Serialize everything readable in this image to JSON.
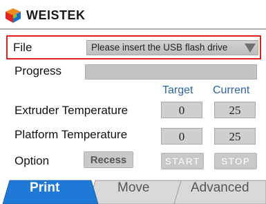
{
  "header": {
    "brand": "WEISTEK",
    "logo_icon": "weistek-cube-logo-icon"
  },
  "file": {
    "label": "File",
    "selected": "Please insert the USB flash drive",
    "dropdown_icon": "triangle-down-icon"
  },
  "progress": {
    "label": "Progress",
    "value": 0
  },
  "columns": {
    "target": "Target",
    "current": "Current"
  },
  "extruder": {
    "label": "Extruder Temperature",
    "target": "0",
    "current": "25"
  },
  "platform": {
    "label": "Platform Temperature",
    "target": "0",
    "current": "25"
  },
  "option": {
    "label": "Option",
    "recess": "Recess",
    "start": "START",
    "stop": "STOP"
  },
  "tabs": {
    "print": "Print",
    "move": "Move",
    "advanced": "Advanced",
    "active": "print"
  },
  "colors": {
    "highlight_border": "#e0201c",
    "column_header": "#2a63a8",
    "active_tab": "#1f79d6",
    "inactive_tab": "#d9d9d9"
  }
}
